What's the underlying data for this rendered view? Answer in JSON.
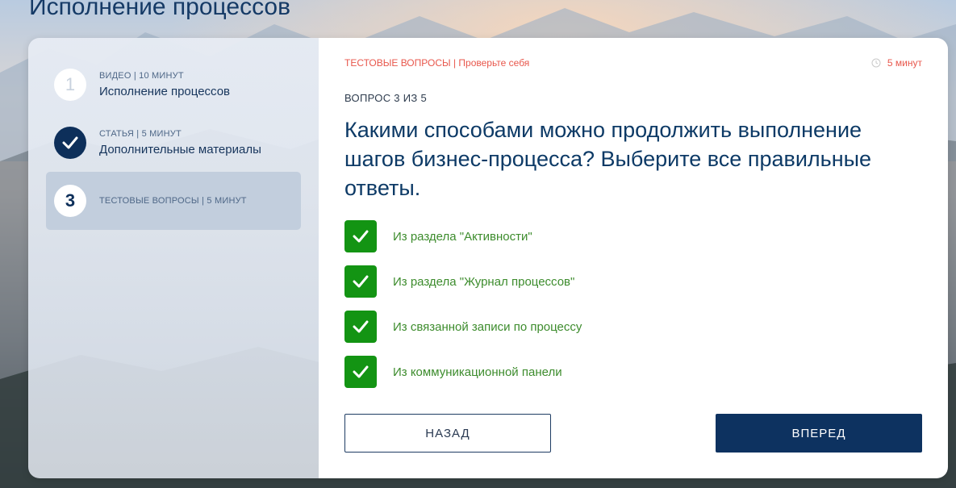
{
  "page": {
    "title": "Исполнение процессов"
  },
  "sidebar": {
    "items": [
      {
        "number": "1",
        "meta": "ВИДЕО | 10 МИНУТ",
        "label": "Исполнение процессов",
        "state": "pending"
      },
      {
        "number": "",
        "meta": "СТАТЬЯ | 5 МИНУТ",
        "label": "Дополнительные материалы",
        "state": "done",
        "icon": "check-icon"
      },
      {
        "number": "3",
        "meta": "ТЕСТОВЫЕ ВОПРОСЫ | 5 МИНУТ",
        "label": "",
        "state": "current"
      }
    ]
  },
  "quiz": {
    "header": "ТЕСТОВЫЕ ВОПРОСЫ | Проверьте себя",
    "timer": "5 минут",
    "timer_icon": "clock-icon",
    "progress": "ВОПРОС 3 ИЗ 5",
    "question": "Какими способами можно продолжить выполнение шагов бизнес-процесса? Выберите все правильные ответы.",
    "answers": [
      {
        "text": "Из раздела \"Активности\"",
        "checked": true
      },
      {
        "text": "Из раздела \"Журнал процессов\"",
        "checked": true
      },
      {
        "text": "Из связанной записи по процессу",
        "checked": true
      },
      {
        "text": "Из коммуникационной панели",
        "checked": true
      }
    ],
    "back_label": "НАЗАД",
    "next_label": "ВПЕРЕД"
  },
  "colors": {
    "accent": "#0d3260",
    "check": "#139413",
    "header_red": "#e8574c"
  }
}
